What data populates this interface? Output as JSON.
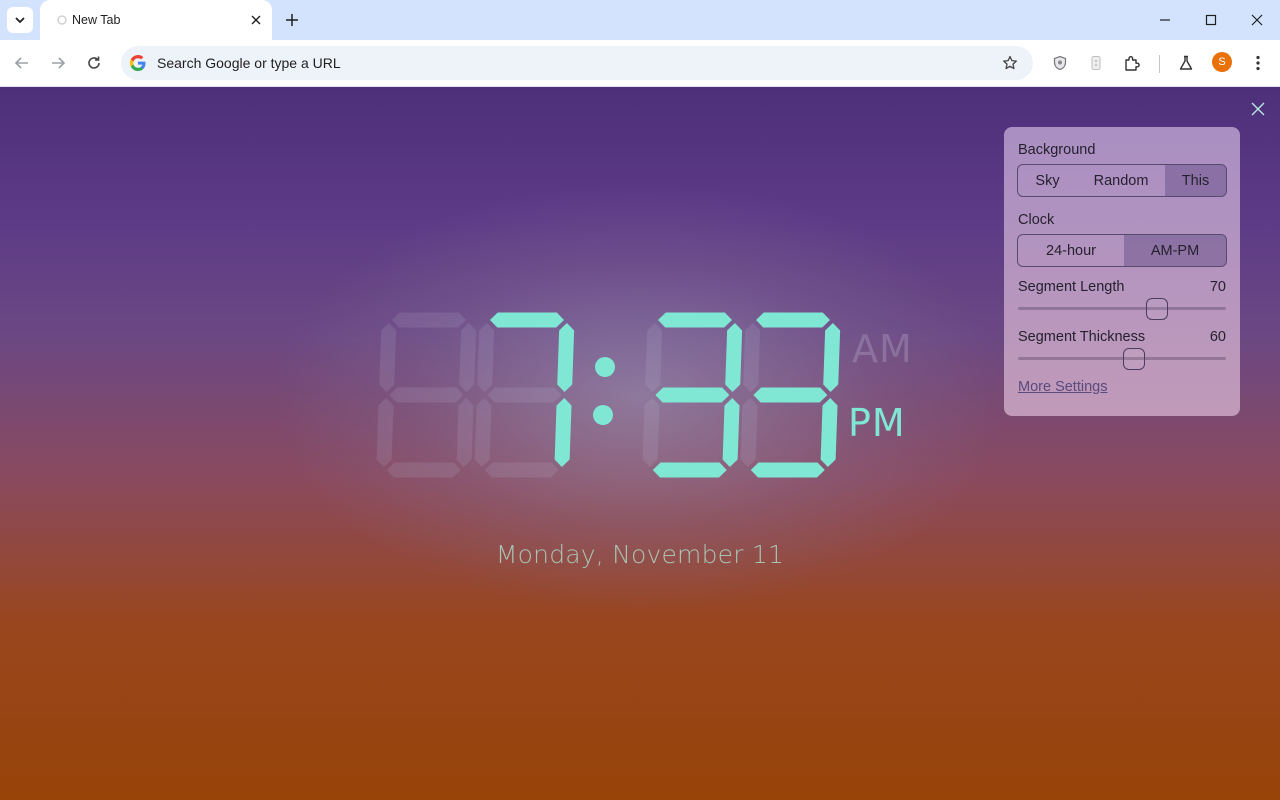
{
  "browser": {
    "tab_title": "New Tab",
    "omnibox_placeholder": "Search Google or type a URL",
    "avatar_initial": "S"
  },
  "clock": {
    "time": "07:33",
    "am_label": "AM",
    "pm_label": "PM",
    "active_period": "PM",
    "date": "Monday, November 11",
    "segment_color": "#7fe7d3",
    "ghost_color": "rgba(200,200,225,0.14)"
  },
  "settings": {
    "background": {
      "label": "Background",
      "options": [
        "Sky",
        "Random",
        "This"
      ],
      "selected": "This"
    },
    "clock": {
      "label": "Clock",
      "options": [
        "24-hour",
        "AM-PM"
      ],
      "selected": "AM-PM"
    },
    "segment_length": {
      "label": "Segment Length",
      "value": "70"
    },
    "segment_thickness": {
      "label": "Segment Thickness",
      "value": "60"
    },
    "more_settings": "More Settings"
  },
  "colors": {
    "accent": "#7fe7d3",
    "tabbar": "#d3e3fd",
    "avatar": "#e8710a"
  }
}
